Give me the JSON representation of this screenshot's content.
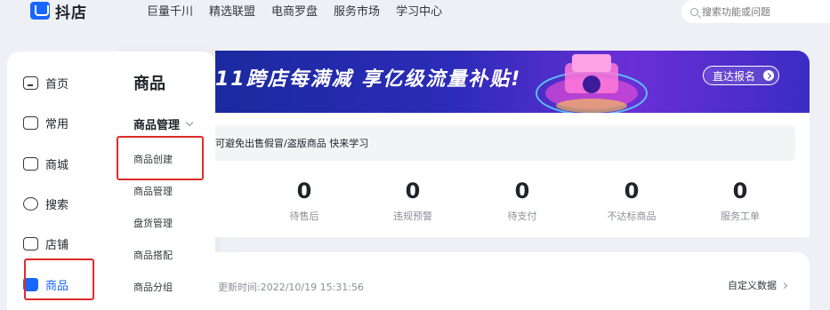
{
  "app": {
    "name": "抖店"
  },
  "topnav": {
    "items": [
      "巨量千川",
      "精选联盟",
      "电商罗盘",
      "服务市场",
      "学习中心"
    ]
  },
  "search": {
    "placeholder": "搜索功能或问题"
  },
  "sidebar": {
    "items": [
      {
        "label": "首页",
        "icon": "home-icon"
      },
      {
        "label": "常用",
        "icon": "folder-icon"
      },
      {
        "label": "商城",
        "icon": "store-icon"
      },
      {
        "label": "搜索",
        "icon": "search-icon"
      },
      {
        "label": "店铺",
        "icon": "shop-icon"
      },
      {
        "label": "商品",
        "icon": "goods-icon",
        "active": true
      }
    ]
  },
  "subnav": {
    "title": "商品",
    "group": "商品管理",
    "items": [
      "商品创建",
      "商品管理",
      "盘货管理",
      "商品搭配",
      "商品分组"
    ]
  },
  "banner": {
    "text": "11跨店每满减 享亿级流量补贴!",
    "cta": "直达报名"
  },
  "notice": {
    "text": "可避免出售假冒/盗版商品 快来学习"
  },
  "stats": [
    {
      "value": "0",
      "label": "待售后"
    },
    {
      "value": "0",
      "label": "违规预警"
    },
    {
      "value": "0",
      "label": "待支付"
    },
    {
      "value": "0",
      "label": "不达标商品"
    },
    {
      "value": "0",
      "label": "服务工单"
    }
  ],
  "data_card": {
    "update_time": "更新时间:2022/10/19 15:31:56",
    "custom_label": "自定义数据"
  },
  "colors": {
    "accent": "#1966ff",
    "highlight": "#e02b2b"
  }
}
